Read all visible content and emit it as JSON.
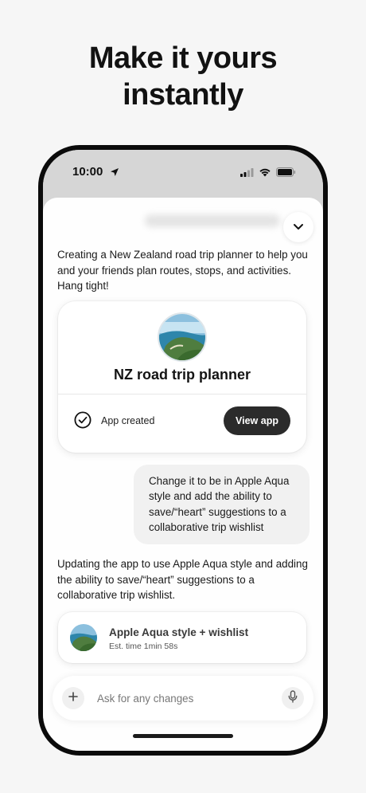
{
  "headline": {
    "line1": "Make it yours",
    "line2": "instantly"
  },
  "status_bar": {
    "time": "10:00",
    "icons": [
      "location-arrow-icon",
      "cellular-signal-icon",
      "wifi-icon",
      "battery-icon"
    ]
  },
  "chat": {
    "assistant_message_1": "Creating a New Zealand road trip planner to help you and your friends plan routes, stops, and activities. Hang tight!",
    "app_card": {
      "title": "NZ road trip planner",
      "status": "App created",
      "view_button": "View app"
    },
    "user_message": "Change it to be in Apple Aqua style and add the ability to save/“heart” suggestions to a collaborative trip wishlist",
    "assistant_message_2": "Updating the app to use Apple Aqua style and adding the ability to save/“heart” suggestions to a collaborative trip wishlist.",
    "progress_card": {
      "title": "Apple Aqua style + wishlist",
      "estimate": "Est. time 1min 58s"
    }
  },
  "composer": {
    "placeholder": "Ask for any changes",
    "value": ""
  },
  "colors": {
    "background": "#f6f6f6",
    "phone_frame": "#0b0b0b",
    "dark_button": "#2b2b2b",
    "user_bubble": "#f1f1f1"
  }
}
